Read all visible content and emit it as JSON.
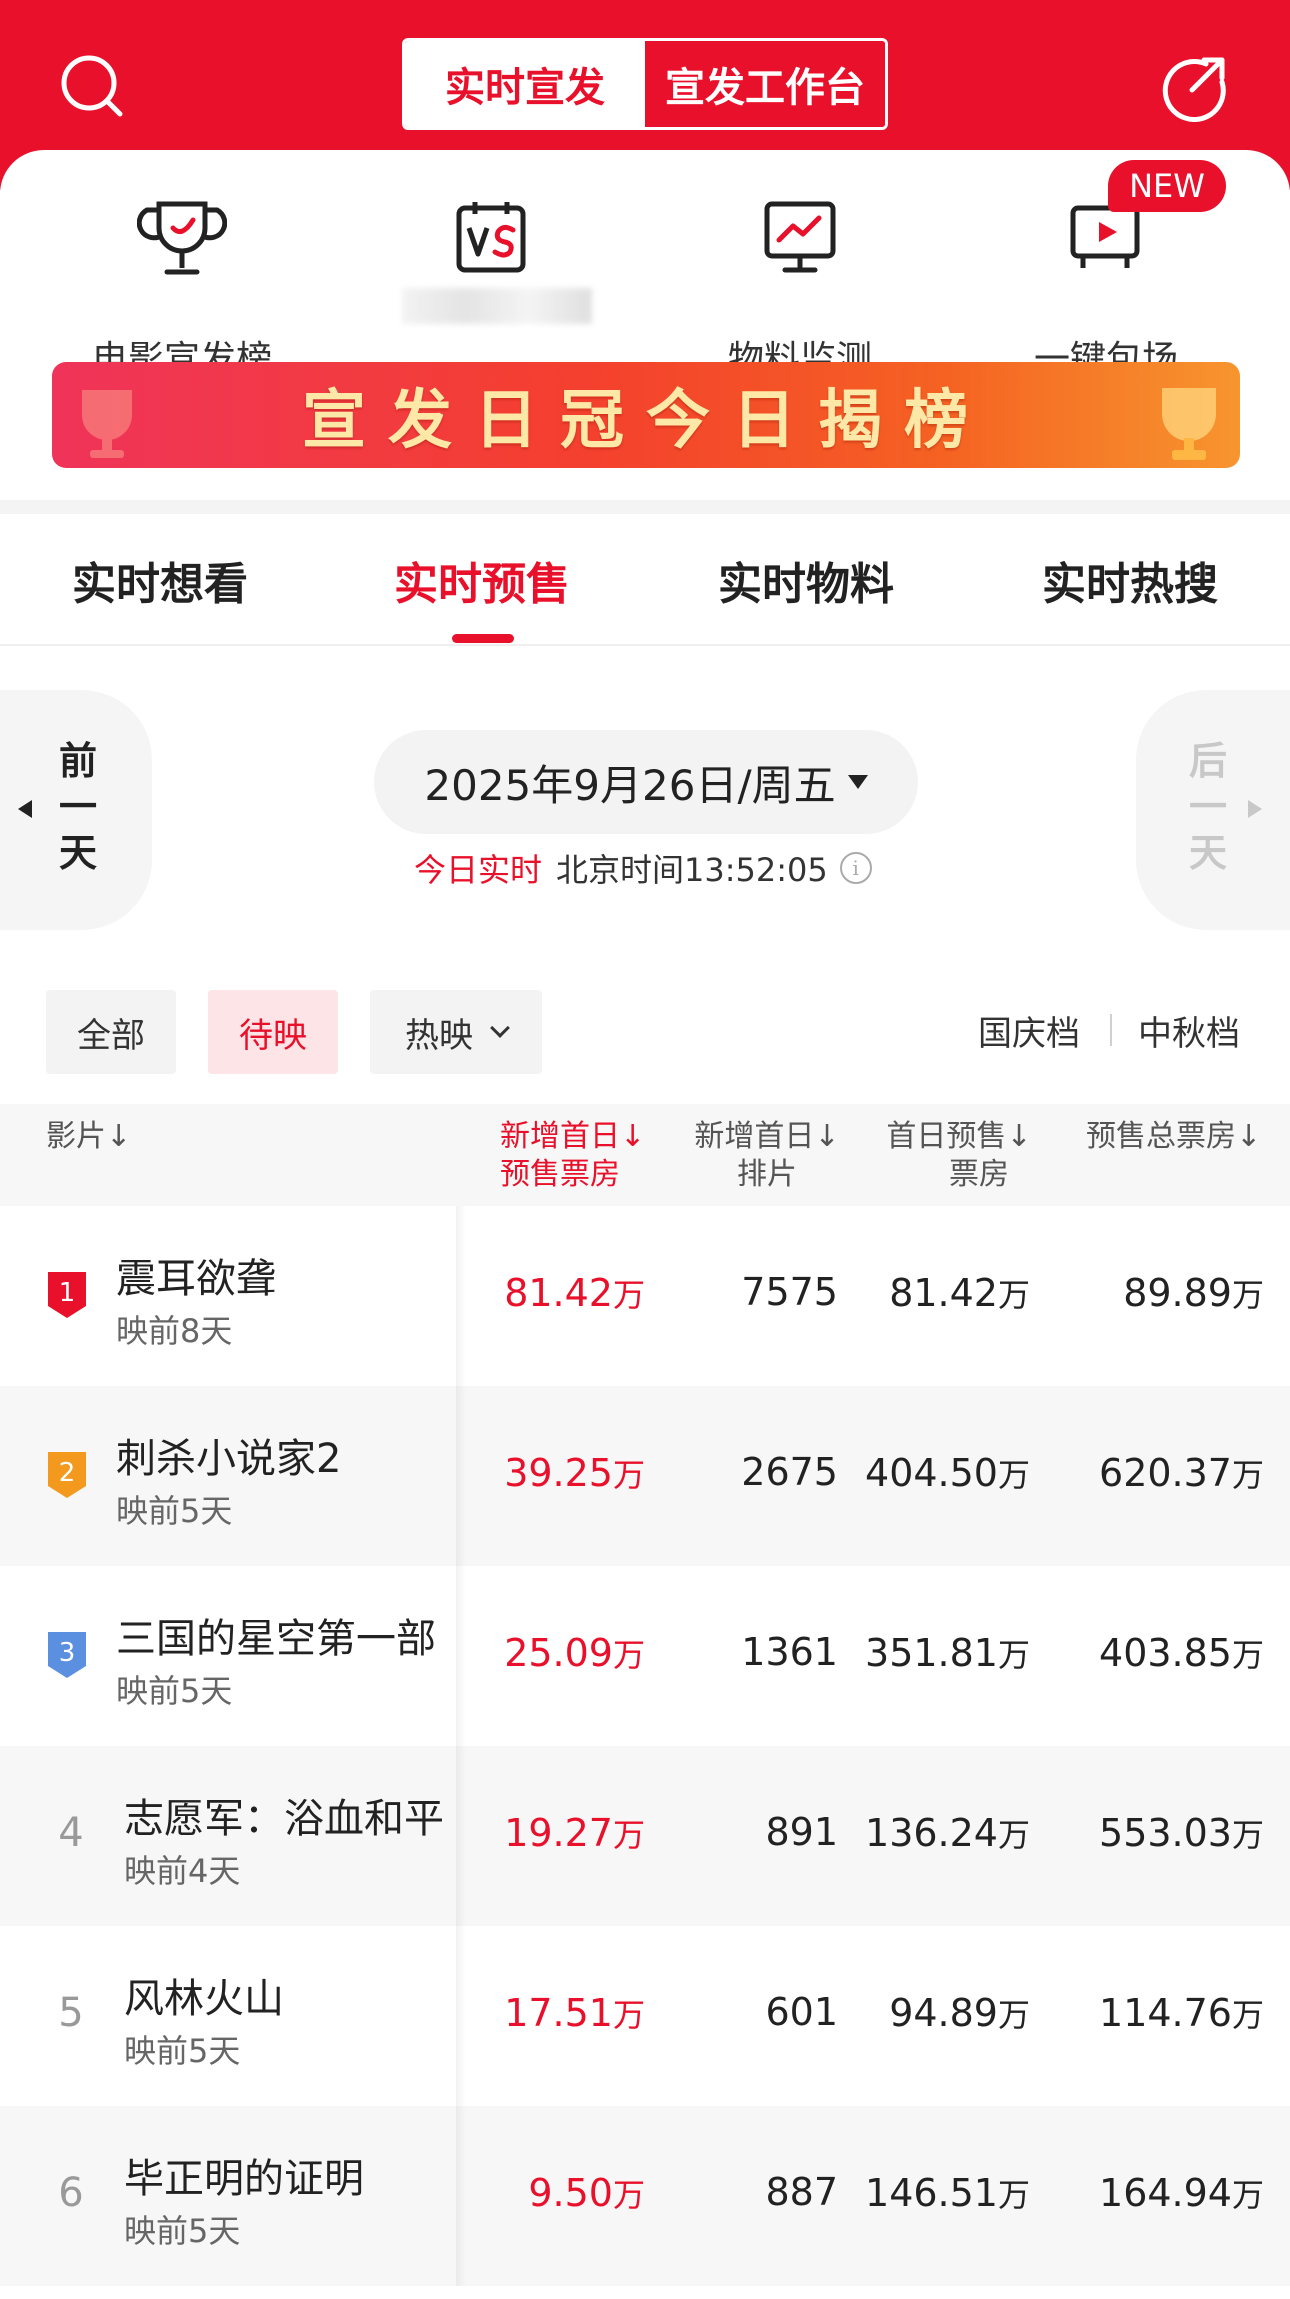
{
  "header": {
    "mode_tabs": [
      "实时宣发",
      "宣发工作台"
    ],
    "search_icon": "search-icon",
    "share_icon": "share-icon",
    "brand_color": "#e8102a"
  },
  "quick_entries": [
    {
      "label": "电影宣发榜",
      "icon": "trophy-icon"
    },
    {
      "label": "",
      "icon": "vs-icon"
    },
    {
      "label": "物料监测",
      "icon": "trend-monitor-icon"
    },
    {
      "label": "一键包场",
      "icon": "video-screen-icon",
      "badge": "NEW"
    }
  ],
  "banner": {
    "text": "宣发日冠今日揭榜"
  },
  "tabs": [
    {
      "label": "实时想看"
    },
    {
      "label": "实时预售",
      "active": true
    },
    {
      "label": "实时物料"
    },
    {
      "label": "实时热搜"
    }
  ],
  "date_nav": {
    "prev": [
      "前",
      "一",
      "天"
    ],
    "next": [
      "后",
      "一",
      "天"
    ],
    "date": "2025年9月26日/周五",
    "realtime_label": "今日实时",
    "beijing_time": "北京时间13:52:05"
  },
  "filters": {
    "status": [
      "全部",
      "待映",
      "热映"
    ],
    "active": "待映",
    "seasons": [
      "国庆档",
      "中秋档"
    ]
  },
  "table": {
    "headers": {
      "film": "影片↓",
      "new_first_day_presale_l1": "新增首日↓",
      "new_first_day_presale_l2": "预售票房",
      "new_first_day_screenings_l1": "新增首日↓",
      "new_first_day_screenings_l2": "排片",
      "first_day_presale_l1": "首日预售↓",
      "first_day_presale_l2": "票房",
      "total_presale": "预售总票房↓"
    },
    "unit": "万",
    "rows": [
      {
        "rank": "1",
        "title": "震耳欲聋",
        "sub": "映前8天",
        "new_presale": "81.42",
        "screenings": "7575",
        "first_day": "81.42",
        "total": "89.89"
      },
      {
        "rank": "2",
        "title": "刺杀小说家2",
        "sub": "映前5天",
        "new_presale": "39.25",
        "screenings": "2675",
        "first_day": "404.50",
        "total": "620.37"
      },
      {
        "rank": "3",
        "title": "三国的星空第一部",
        "sub": "映前5天",
        "new_presale": "25.09",
        "screenings": "1361",
        "first_day": "351.81",
        "total": "403.85"
      },
      {
        "rank": "4",
        "title": "志愿军：浴血和平",
        "sub": "映前4天",
        "new_presale": "19.27",
        "screenings": "891",
        "first_day": "136.24",
        "total": "553.03"
      },
      {
        "rank": "5",
        "title": "风林火山",
        "sub": "映前5天",
        "new_presale": "17.51",
        "screenings": "601",
        "first_day": "94.89",
        "total": "114.76"
      },
      {
        "rank": "6",
        "title": "毕正明的证明",
        "sub": "映前5天",
        "new_presale": "9.50",
        "screenings": "887",
        "first_day": "146.51",
        "total": "164.94"
      }
    ]
  }
}
